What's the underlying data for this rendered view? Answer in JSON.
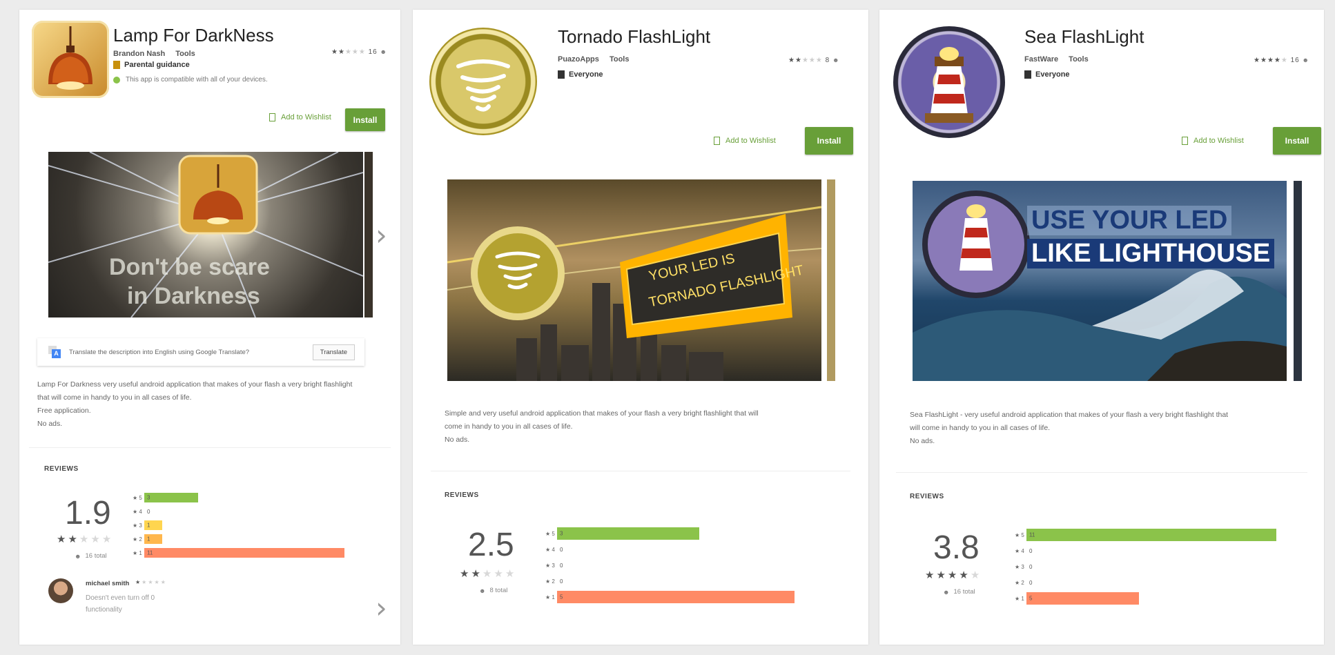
{
  "colors": {
    "install": "#689f38",
    "bar5": "#8bc34a",
    "bar4": "#b3d465",
    "bar3": "#ffd54f",
    "bar2": "#ffb74d",
    "bar1": "#ff8a65"
  },
  "apps": [
    {
      "title": "Lamp For DarkNess",
      "developer": "Brandon Nash",
      "category": "Tools",
      "content_rating": "Parental guidance",
      "compat": "This app is compatible with all of your devices.",
      "top_rating_count": "16",
      "stars_on": 2,
      "wishlist": "Add to Wishlist",
      "install": "Install",
      "shot_line1": "Don't be scare",
      "shot_line2": "in Darkness",
      "translate": {
        "text": "Translate the description into English using Google Translate?",
        "button": "Translate"
      },
      "description": [
        "Lamp For Darkness very useful android application that makes of your flash a very bright flashlight",
        "that will come in handy to you in all cases of life.",
        "Free application.",
        "No ads."
      ],
      "reviews_heading": "REVIEWS",
      "score": "1.9",
      "total": "16 total",
      "histogram": [
        {
          "stars": "5",
          "count": "3",
          "fraction": 0.27
        },
        {
          "stars": "4",
          "count": "0",
          "fraction": 0
        },
        {
          "stars": "3",
          "count": "1",
          "fraction": 0.09
        },
        {
          "stars": "2",
          "count": "1",
          "fraction": 0.09
        },
        {
          "stars": "1",
          "count": "11",
          "fraction": 1.0
        }
      ],
      "review": {
        "name": "michael smith",
        "text": "Doesn't even turn off 0 functionality",
        "stars_on": 1
      }
    },
    {
      "title": "Tornado FlashLight",
      "developer": "PuazoApps",
      "category": "Tools",
      "content_rating": "Everyone",
      "top_rating_count": "8",
      "stars_on": 2,
      "wishlist": "Add to Wishlist",
      "install": "Install",
      "shot_line1": "YOUR LED IS",
      "shot_line2": "TORNADO FLASHLIGHT",
      "description": [
        "Simple and very useful android application that makes of your flash a very bright flashlight that will",
        "come in handy to you in all cases of life.",
        "No ads."
      ],
      "reviews_heading": "REVIEWS",
      "score": "2.5",
      "total": "8 total",
      "histogram": [
        {
          "stars": "5",
          "count": "3",
          "fraction": 0.6
        },
        {
          "stars": "4",
          "count": "0",
          "fraction": 0
        },
        {
          "stars": "3",
          "count": "0",
          "fraction": 0
        },
        {
          "stars": "2",
          "count": "0",
          "fraction": 0
        },
        {
          "stars": "1",
          "count": "5",
          "fraction": 1.0
        }
      ]
    },
    {
      "title": "Sea FlashLight",
      "developer": "FastWare",
      "category": "Tools",
      "content_rating": "Everyone",
      "top_rating_count": "16",
      "stars_on": 4,
      "wishlist": "Add to Wishlist",
      "install": "Install",
      "shot_line1": "USE YOUR LED",
      "shot_line2": "LIKE LIGHTHOUSE",
      "description": [
        "Sea FlashLight - very useful android application that makes of your flash a very bright flashlight that",
        "will come in handy to you in all cases of life.",
        "No ads."
      ],
      "reviews_heading": "REVIEWS",
      "score": "3.8",
      "total": "16 total",
      "histogram": [
        {
          "stars": "5",
          "count": "11",
          "fraction": 1.0
        },
        {
          "stars": "4",
          "count": "0",
          "fraction": 0
        },
        {
          "stars": "3",
          "count": "0",
          "fraction": 0
        },
        {
          "stars": "2",
          "count": "0",
          "fraction": 0
        },
        {
          "stars": "1",
          "count": "5",
          "fraction": 0.45
        }
      ]
    }
  ]
}
